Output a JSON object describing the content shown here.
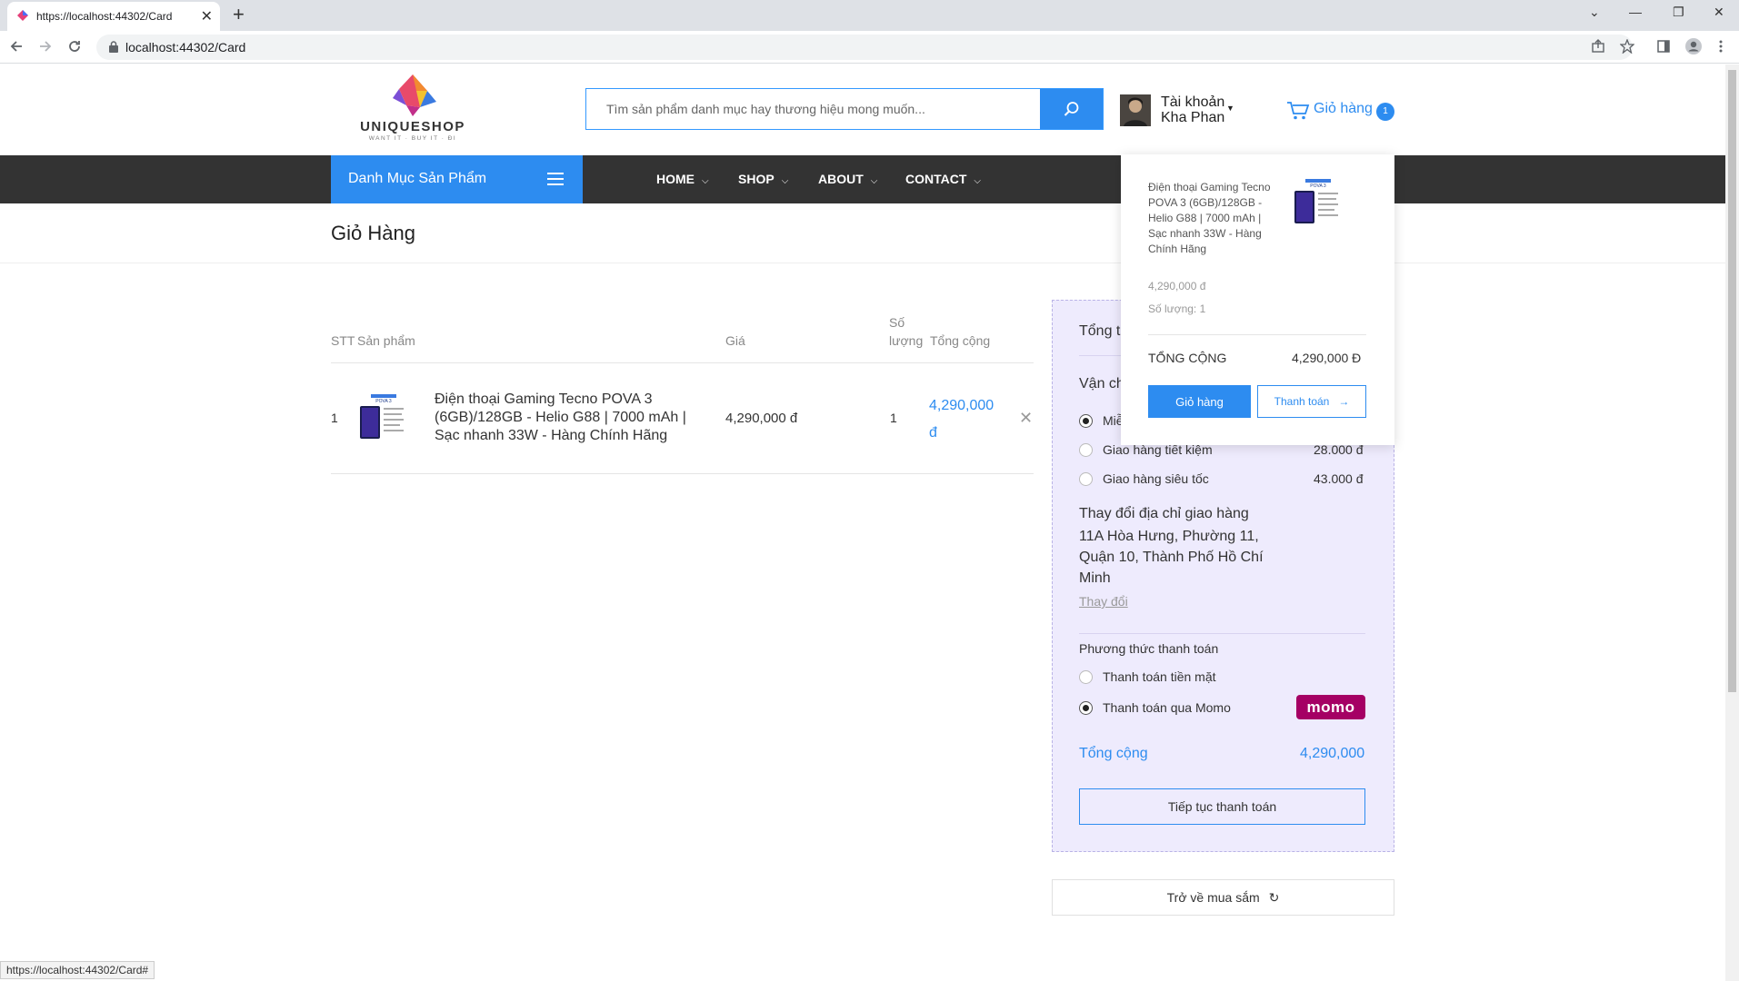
{
  "browser": {
    "tab_title": "https://localhost:44302/Card",
    "tab_close": "✕",
    "new_tab": "+",
    "url": "localhost:44302/Card",
    "status_url": "https://localhost:44302/Card#",
    "window_controls": [
      "⌄",
      "—",
      "❐",
      "✕"
    ]
  },
  "header": {
    "search_placeholder": "Tìm sản phẩm danh mục hay thương hiệu mong muốn...",
    "account_line1": "Tài khoản",
    "account_line2": "Kha Phan",
    "cart_label": "Giỏ hàng",
    "cart_count": "1"
  },
  "nav": {
    "category_label": "Danh Mục Sản Phẩm",
    "items": [
      "HOME",
      "SHOP",
      "ABOUT",
      "CONTACT"
    ]
  },
  "page": {
    "title": "Giỏ Hàng"
  },
  "table": {
    "headers": {
      "stt": "STT",
      "product": "Sản phẩm",
      "price": "Giá",
      "qty_line1": "Số",
      "qty_line2": "lượng",
      "total": "Tổng cộng"
    },
    "rows": [
      {
        "stt": "1",
        "name": "Điện thoại Gaming Tecno POVA 3 (6GB)/128GB - Helio G88 | 7000 mAh | Sạc nhanh 33W - Hàng Chính Hãng",
        "price": "4,290,000 đ",
        "qty": "1",
        "total": "4,290,000 đ",
        "remove": "✕"
      }
    ]
  },
  "summary": {
    "title": "Tổng t",
    "shipping_label": "Vận ch",
    "shipping_options": [
      {
        "label": "Miễ",
        "price": "",
        "selected": true
      },
      {
        "label": "Giao hàng tiết kiệm",
        "price": "28.000 đ",
        "selected": false
      },
      {
        "label": "Giao hàng siêu tốc",
        "price": "43.000 đ",
        "selected": false
      }
    ],
    "address_heading": "Thay đổi địa chỉ giao hàng",
    "address": "11A Hòa Hưng, Phường 11, Quận 10, Thành Phố Hồ Chí Minh",
    "change_link": "Thay đổi",
    "payment_label": "Phương thức thanh toán",
    "payment_options": [
      {
        "label": "Thanh toán tiền mặt",
        "selected": false
      },
      {
        "label": "Thanh toán qua Momo",
        "selected": true
      }
    ],
    "momo_logo": "momo",
    "total_label": "Tổng cộng",
    "total_value": "4,290,000",
    "continue_button": "Tiếp tục thanh toán",
    "back_button": "Trở về mua sắm"
  },
  "dropdown": {
    "product_name": "Điện thoại Gaming Tecno POVA 3 (6GB)/128GB - Helio G88 | 7000 mAh | Sạc nhanh 33W - Hàng Chính Hãng",
    "price": "4,290,000 đ",
    "quantity": "Số lượng: 1",
    "total_label": "TỔNG CỘNG",
    "total_value": "4,290,000 Đ",
    "cart_button": "Giỏ hàng",
    "pay_button": "Thanh toán"
  },
  "colors": {
    "accent": "#2d8cf0",
    "navbar": "#333333",
    "summary_bg": "#eeebfd",
    "momo": "#a50064"
  }
}
